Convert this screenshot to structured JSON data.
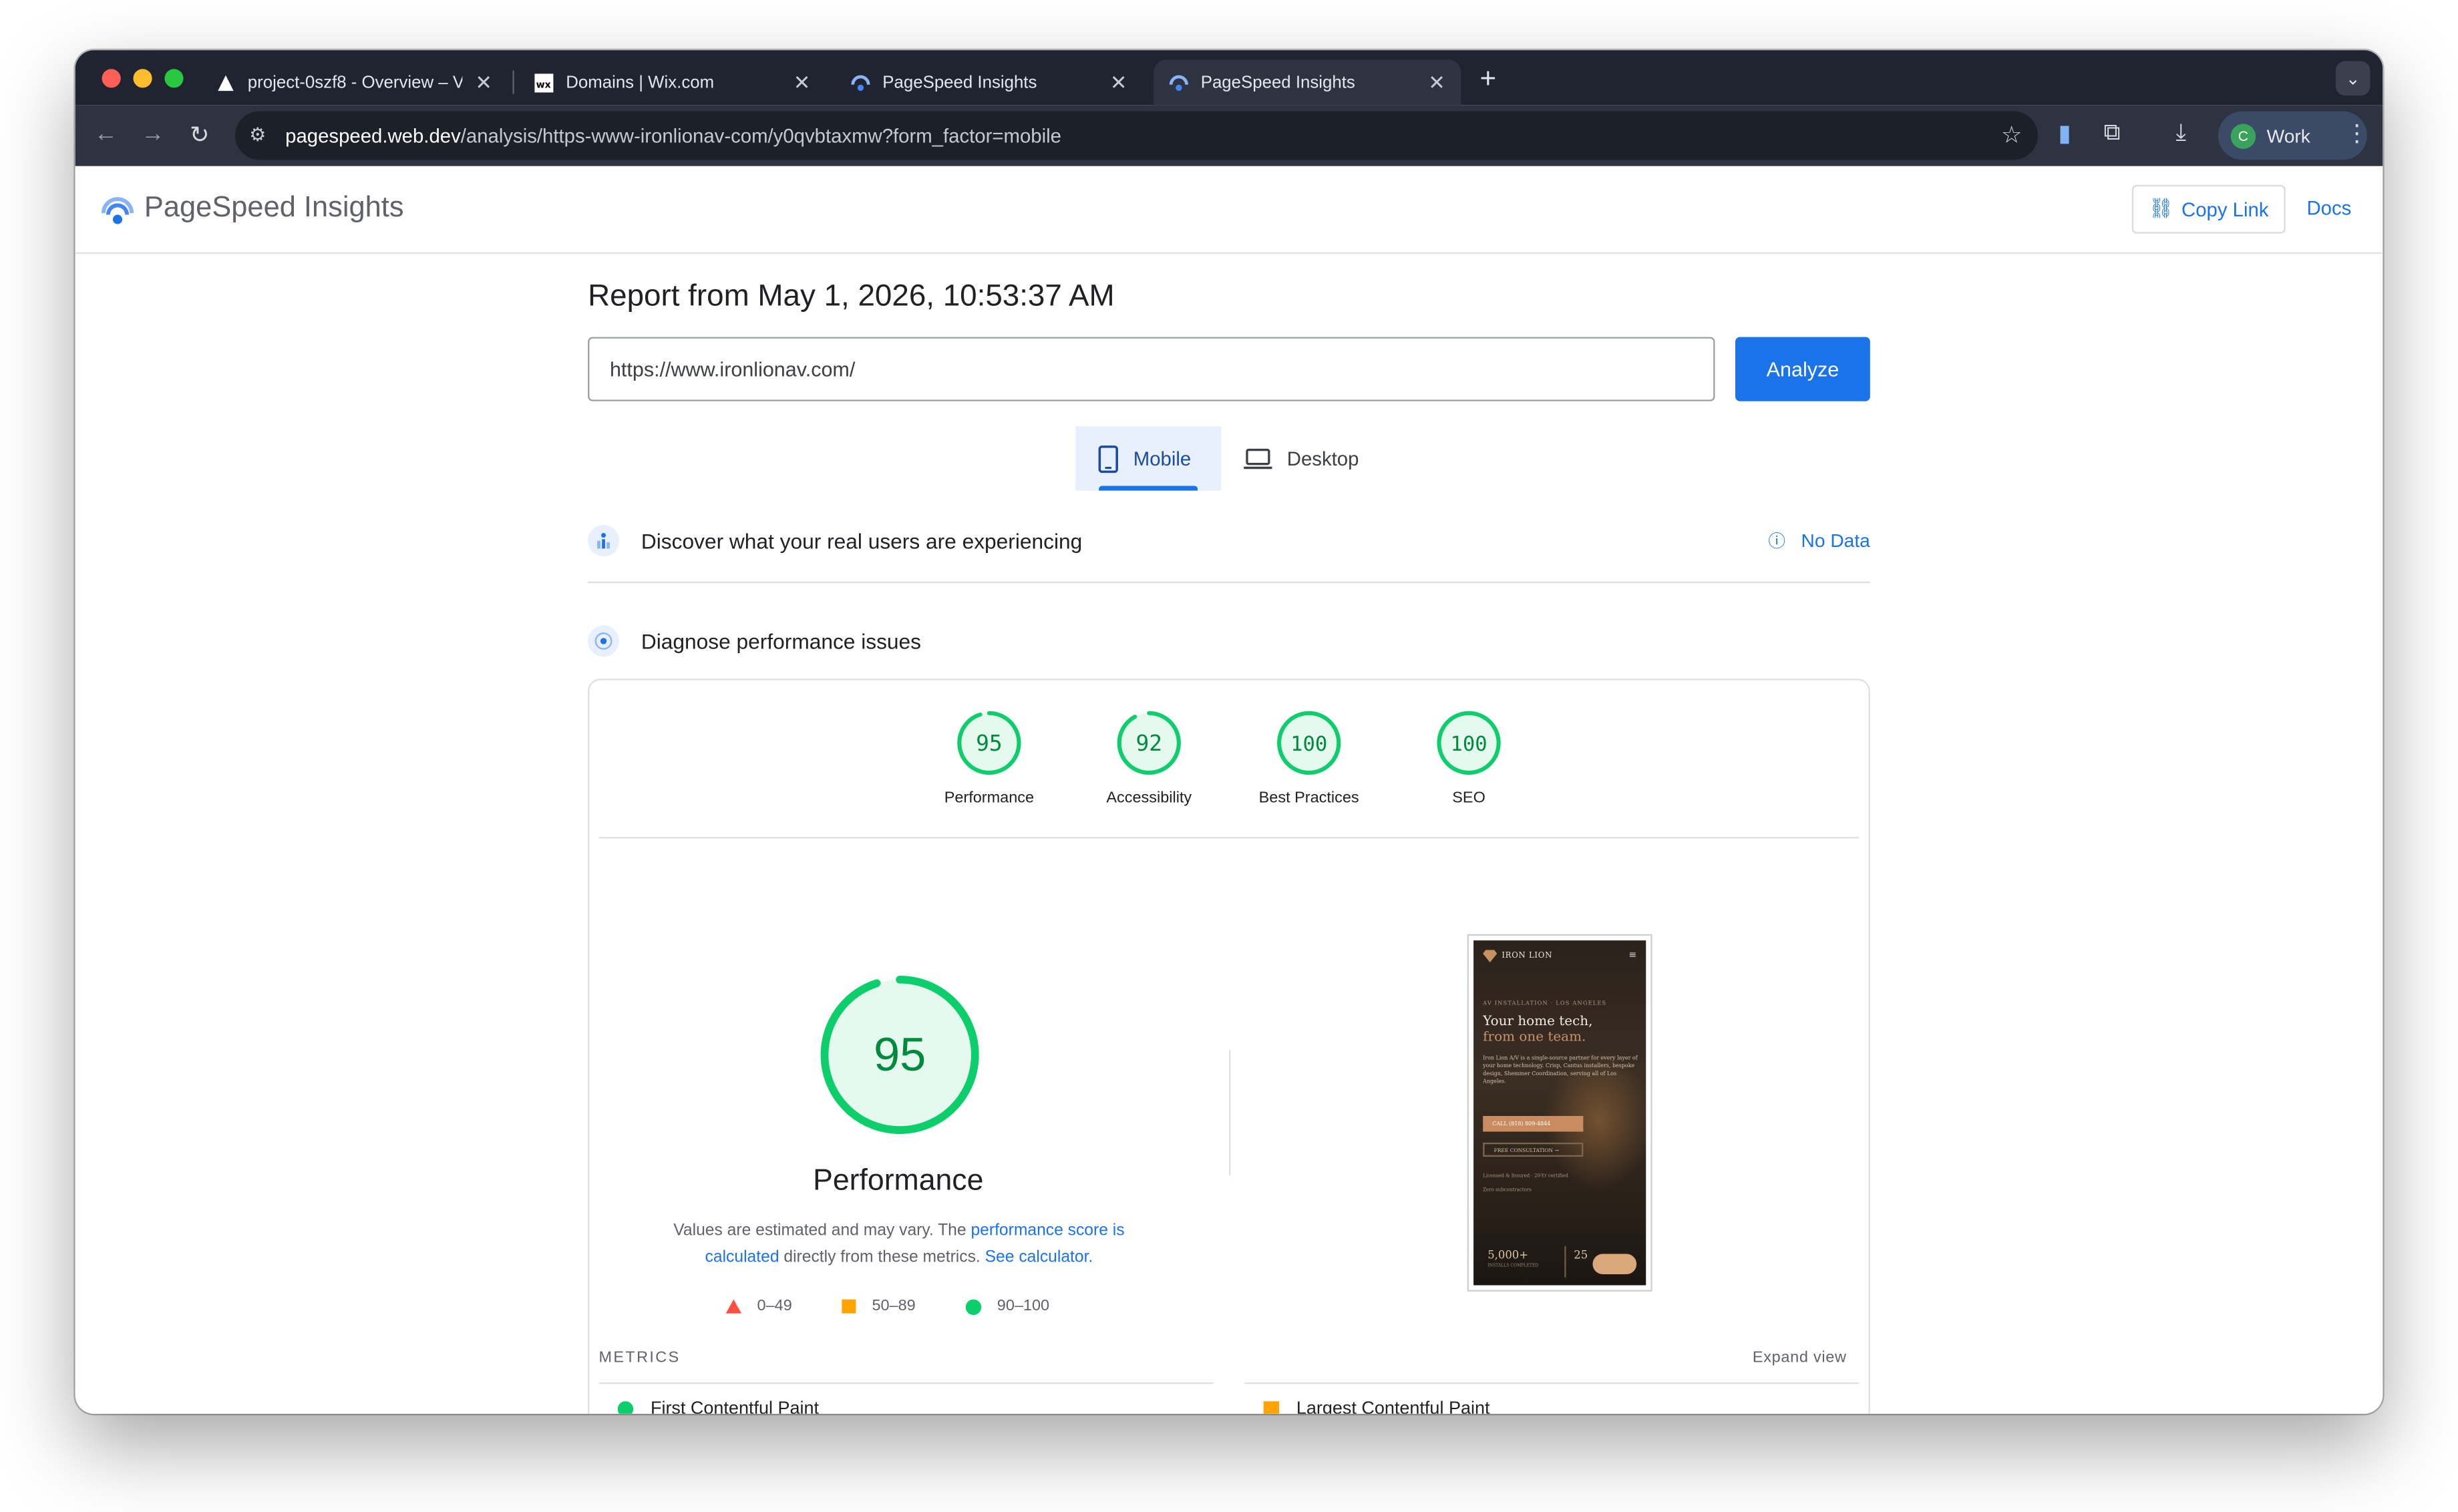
{
  "browser": {
    "tabs": [
      {
        "title": "project-0szf8 - Overview – V",
        "favicon": "vercel-triangle-icon"
      },
      {
        "title": "Domains | Wix.com",
        "favicon": "wix-icon"
      },
      {
        "title": "PageSpeed Insights",
        "favicon": "pagespeed-icon"
      },
      {
        "title": "PageSpeed Insights",
        "favicon": "pagespeed-icon",
        "active": true
      }
    ],
    "url_host": "pagespeed.web.dev",
    "url_path": "/analysis/https-www-ironlionav-com/y0qvbtaxmw?form_factor=mobile",
    "profile_initial": "C",
    "profile_label": "Work"
  },
  "header": {
    "app_name": "PageSpeed Insights",
    "copy_link": "Copy Link",
    "docs": "Docs"
  },
  "report": {
    "title": "Report from May 1, 2026, 10:53:37 AM",
    "url_value": "https://www.ironlionav.com/",
    "analyze": "Analyze",
    "tabs": {
      "mobile": "Mobile",
      "desktop": "Desktop"
    }
  },
  "sections": {
    "real_users": "Discover what your real users are experiencing",
    "no_data": "No Data",
    "diagnose": "Diagnose performance issues"
  },
  "scores": [
    {
      "label": "Performance",
      "value": "95"
    },
    {
      "label": "Accessibility",
      "value": "92"
    },
    {
      "label": "Best Practices",
      "value": "100"
    },
    {
      "label": "SEO",
      "value": "100"
    }
  ],
  "performance": {
    "score": "95",
    "label": "Performance",
    "disclaimer_1": "Values are estimated and may vary. The ",
    "disclaimer_link_1": "performance score is calculated",
    "disclaimer_2": " directly from these metrics. ",
    "disclaimer_link_2": "See calculator.",
    "legend": [
      "0–49",
      "50–89",
      "90–100"
    ]
  },
  "screenshot": {
    "brand": "IRON LION",
    "kicker": "AV INSTALLATION · LOS ANGELES",
    "headline_1": "Your home tech,",
    "headline_2": "from one team.",
    "body": "Iron Lion A/V is a single-source partner for every layer of your home technology. Crisp, Cantus installers, bespoke design, Shemmer Coordination, serving all of Los Angeles.",
    "cta": "CALL (818) 809-4844",
    "cta2": "FREE CONSULTATION →",
    "meta1": "Licensed & Insured · 20-Yr certified",
    "meta2": "Zero subcontractors",
    "stat1": "5,000+",
    "stat1_sub": "INSTALLS COMPLETED",
    "stat2": "25"
  },
  "metrics": {
    "label": "METRICS",
    "expand": "Expand view",
    "items": [
      "First Contentful Paint",
      "Largest Contentful Paint"
    ]
  },
  "colors": {
    "pass": "#0cce6b",
    "average": "#ffa400",
    "fail": "#ff4e42",
    "accent": "#1a73e8"
  }
}
